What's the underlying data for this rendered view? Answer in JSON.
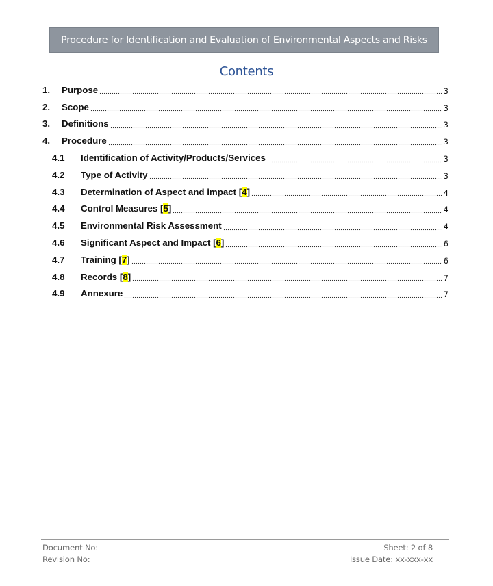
{
  "header": {
    "title": "Procedure for Identification and Evaluation of Environmental Aspects and Risks"
  },
  "toc": {
    "title": "Contents",
    "entries": [
      {
        "number": "1.",
        "label": "Purpose",
        "ref": "",
        "page": "3",
        "level": 1
      },
      {
        "number": "2.",
        "label": "Scope",
        "ref": "",
        "page": "3",
        "level": 1
      },
      {
        "number": "3.",
        "label": "Definitions",
        "ref": "",
        "page": "3",
        "level": 1
      },
      {
        "number": "4.",
        "label": "Procedure",
        "ref": "",
        "page": "3",
        "level": 1
      },
      {
        "number": "4.1",
        "label": "Identification of Activity/Products/Services",
        "ref": "",
        "page": "3",
        "level": 2
      },
      {
        "number": "4.2",
        "label": "Type of Activity",
        "ref": "",
        "page": "3",
        "level": 2
      },
      {
        "number": "4.3",
        "label": "Determination of Aspect and impact",
        "ref": "4",
        "page": "4",
        "level": 2
      },
      {
        "number": "4.4",
        "label": "Control Measures",
        "ref": "5",
        "page": "4",
        "level": 2
      },
      {
        "number": "4.5",
        "label": "Environmental Risk Assessment",
        "ref": "",
        "page": "4",
        "level": 2
      },
      {
        "number": "4.6",
        "label": "Significant Aspect and Impact",
        "ref": "6",
        "page": "6",
        "level": 2
      },
      {
        "number": "4.7",
        "label": "Training",
        "ref": "7",
        "page": "6",
        "level": 2
      },
      {
        "number": "4.8",
        "label": "Records",
        "ref": "8",
        "page": "7",
        "level": 2
      },
      {
        "number": "4.9",
        "label": "Annexure",
        "ref": "",
        "page": "7",
        "level": 2
      }
    ]
  },
  "footer": {
    "document_no_label": "Document No:",
    "revision_no_label": "Revision No:",
    "sheet": "Sheet: 2 of 8",
    "issue_date": "Issue Date: xx-xxx-xx"
  },
  "colors": {
    "banner_bg": "#8e959e",
    "title_blue": "#2f5597",
    "highlight": "#ffff00"
  }
}
